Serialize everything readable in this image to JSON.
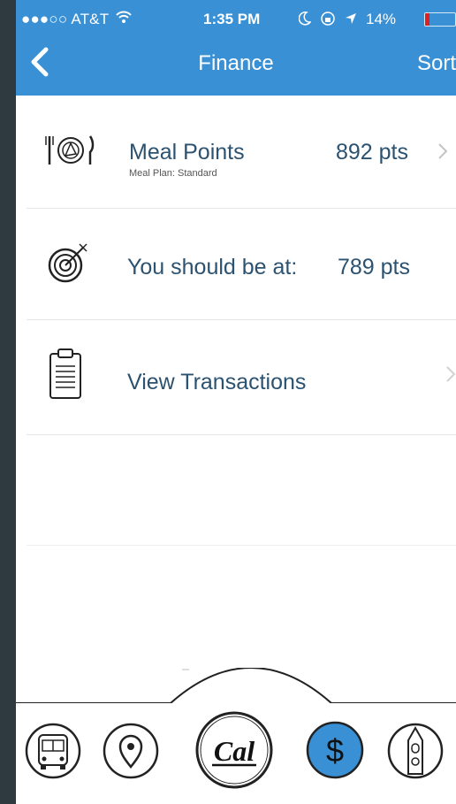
{
  "status_bar": {
    "carrier": "●●●○○ AT&T",
    "time": "1:35 PM",
    "battery": "14%",
    "battery_level": 0.14
  },
  "nav": {
    "back_icon": "chevron-left-icon",
    "title": "Finance",
    "sort_label": "Sort"
  },
  "rows": [
    {
      "icon": "meal-plate-icon",
      "title": "Meal Points",
      "subtitle": "Meal Plan: Standard",
      "value": "892 pts",
      "has_chevron": true
    },
    {
      "icon": "target-icon",
      "title": "You should be at:",
      "value": "789 pts",
      "has_chevron": false
    },
    {
      "icon": "clipboard-icon",
      "title": "View Transactions",
      "has_chevron": true
    }
  ],
  "tabbar": {
    "tabs": [
      {
        "icon": "bus-icon"
      },
      {
        "icon": "location-pin-icon"
      },
      {
        "icon": "cal-logo-icon",
        "label": "Cal"
      },
      {
        "icon": "dollar-icon",
        "label": "$",
        "active": true
      },
      {
        "icon": "campanile-tower-icon"
      }
    ]
  },
  "colors": {
    "header": "#3a90d5",
    "text": "#2b5270",
    "active_tab": "#3a90d5",
    "background": "#2f3940"
  }
}
